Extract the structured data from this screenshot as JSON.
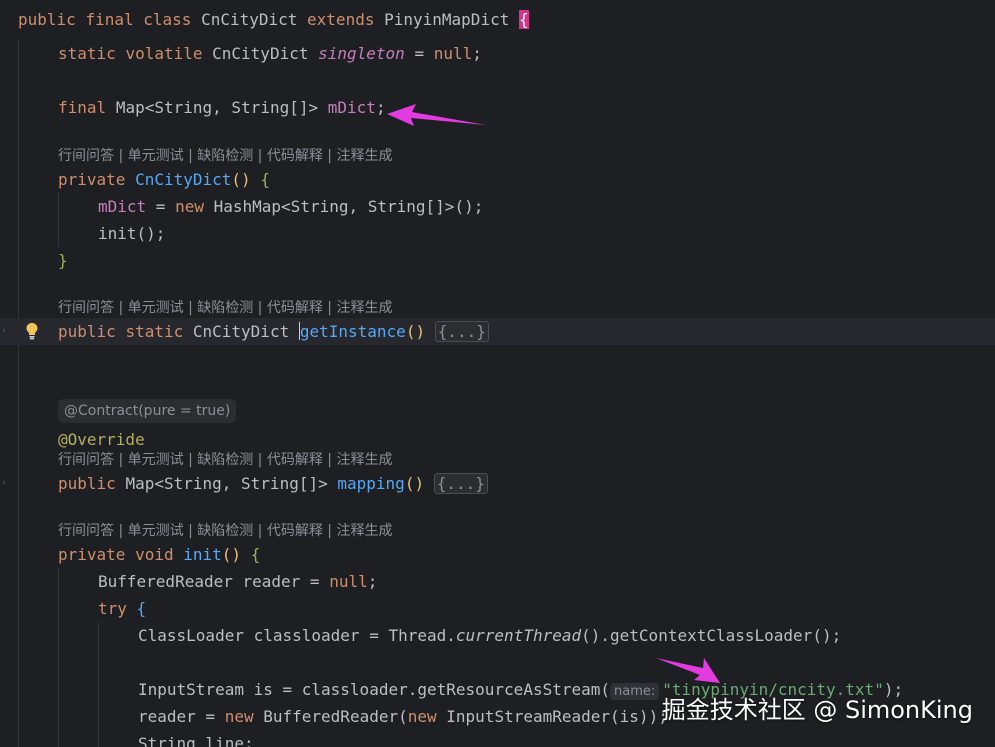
{
  "code": {
    "class_decl": {
      "kw1": "public",
      "kw2": "final",
      "kw3": "class",
      "name": "CnCityDict",
      "kw4": "extends",
      "parent": "PinyinMapDict",
      "brace": "{"
    },
    "singleton_line": {
      "kw1": "static",
      "kw2": "volatile",
      "type": "CnCityDict",
      "field": "singleton",
      "rest": " = ",
      "nul": "null",
      ";": ";"
    },
    "map_line": {
      "kw": "final",
      "type1": "Map",
      "lt": "<",
      "type2": "String, String[]",
      "gt": ">",
      "field": "mDict",
      "semi": ";"
    },
    "hint_text": "行间问答 | 单元测试 | 缺陷检测 | 代码解释 | 注释生成",
    "ctor": {
      "kw": "private",
      "name": "CnCityDict",
      "parens": "()",
      "brace": "{"
    },
    "ctor_body1": {
      "field": "mDict",
      "eq": " = ",
      "kw": "new",
      "rest": " HashMap<String, String[]>();"
    },
    "ctor_body2": {
      "text": "init();"
    },
    "close_brace": "}",
    "getinstance": {
      "kw1": "public",
      "kw2": "static",
      "type": "CnCityDict",
      "name": "getInstance",
      "parens": "()",
      "fold": "{...}"
    },
    "contract": "@Contract(pure = true)",
    "override": "@Override",
    "mapping": {
      "kw": "public",
      "type": "Map<String, String[]>",
      "name": "mapping",
      "parens": "()",
      "fold": "{...}"
    },
    "init_decl": {
      "kw1": "private",
      "kw2": "void",
      "name": "init",
      "parens": "()",
      "brace": "{"
    },
    "reader_line": {
      "text": "BufferedReader reader = ",
      "nul": "null",
      "semi": ";"
    },
    "try_line": {
      "kw": "try",
      "brace": "{"
    },
    "classloader_line": {
      "pre": "ClassLoader classloader = Thread.",
      "method": "currentThread",
      "post": "().getContextClassLoader();"
    },
    "inputstream_line": {
      "pre": "InputStream is = classloader.getResourceAsStream(",
      "param_hint": "name:",
      "str": "\"tinypinyin/cncity.txt\"",
      "post": ");"
    },
    "reader_assign": {
      "field": "reader = ",
      "kw1": "new",
      "mid": " BufferedReader(",
      "kw2": "new",
      "post": " InputStreamReader(is));"
    },
    "string_line": {
      "text": "String line;"
    }
  },
  "watermark": "掘金技术社区 @ SimonKing",
  "colors": {
    "background": "#1e1f22",
    "keyword": "#cf8e6d",
    "method": "#56a8f5",
    "field": "#c77dbb",
    "string": "#6aab73",
    "arrow": "#e23be0"
  },
  "icons": {
    "bulb": "lightbulb-icon",
    "fold": "fold-arrow-icon"
  }
}
